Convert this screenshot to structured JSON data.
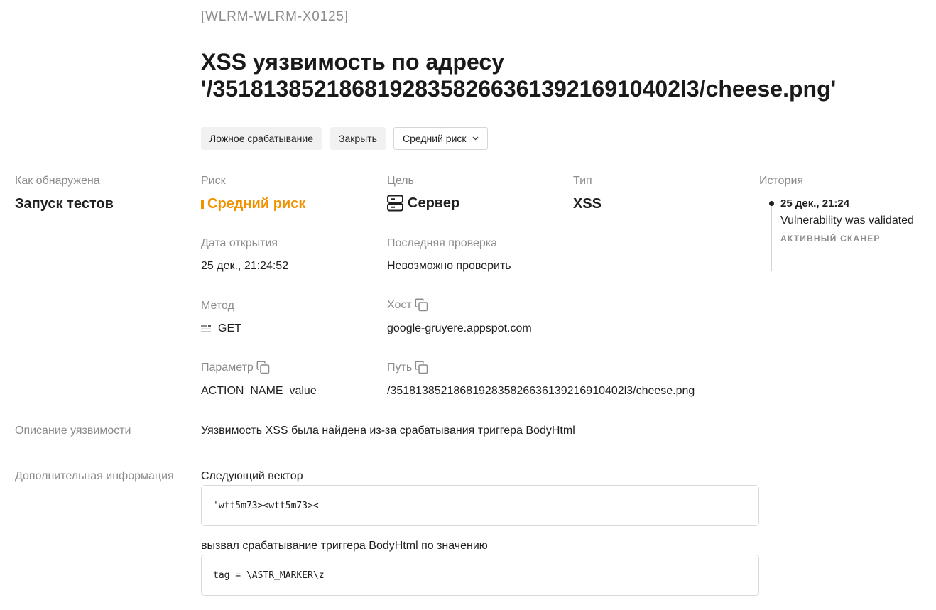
{
  "header": {
    "id": "[WLRM-WLRM-X0125]",
    "title_line1": "XSS уязвимость по адресу",
    "title_line2": "'/3518138521868192835826636139216910402l3/cheese.png'"
  },
  "actions": {
    "false_positive": "Ложное срабатывание",
    "close": "Закрыть",
    "risk_select": "Средний риск"
  },
  "detected": {
    "label": "Как обнаружена",
    "value": "Запуск тестов"
  },
  "risk": {
    "label": "Риск",
    "value": "Средний риск",
    "color": "#f29100"
  },
  "target": {
    "label": "Цель",
    "value": "Сервер",
    "icon": "server-icon"
  },
  "type": {
    "label": "Тип",
    "value": "XSS"
  },
  "opened": {
    "label": "Дата открытия",
    "value": "25 дек., 21:24:52"
  },
  "last_check": {
    "label": "Последняя проверка",
    "value": "Невозможно проверить"
  },
  "method": {
    "label": "Метод",
    "value": "GET",
    "icon": "method-icon"
  },
  "host": {
    "label": "Хост",
    "value": "google-gruyere.appspot.com",
    "icon": "copy-icon"
  },
  "param": {
    "label": "Параметр",
    "value": "ACTION_NAME_value",
    "icon": "copy-icon"
  },
  "path": {
    "label": "Путь",
    "value": "/3518138521868192835826636139216910402l3/cheese.png",
    "icon": "copy-icon"
  },
  "history": {
    "label": "История",
    "entries": [
      {
        "date": "25 дек., 21:24",
        "text": "Vulnerability was validated",
        "source": "АКТИВНЫЙ СКАНЕР"
      }
    ]
  },
  "description": {
    "label": "Описание уязвимости",
    "value": "Уязвимость XSS была найдена из-за срабатывания триггера BodyHtml"
  },
  "extra": {
    "label": "Дополнительная информация",
    "vector_label": "Следующий вектор",
    "vector_code": "'wtt5m73><wtt5m73><",
    "trigger_label": "вызвал срабатывание триггера BodyHtml по значению",
    "trigger_code": "tag = \\ASTR_MARKER\\z"
  }
}
